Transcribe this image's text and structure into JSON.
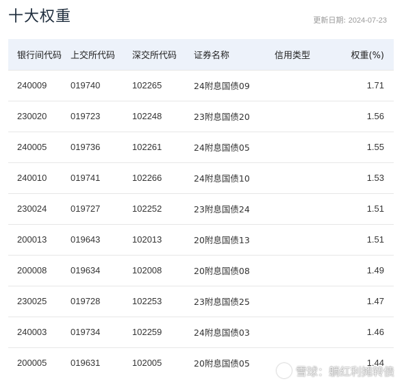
{
  "title": "十大权重",
  "update": {
    "label": "更新日期:",
    "date": "2024-07-23"
  },
  "table": {
    "headers": [
      "银行间代码",
      "上交所代码",
      "深交所代码",
      "证券名称",
      "信用类型",
      "权重(%)"
    ],
    "rows": [
      {
        "bank_code": "240009",
        "sh_code": "019740",
        "sz_code": "102265",
        "name": "24附息国债09",
        "credit_type": "",
        "weight": "1.71"
      },
      {
        "bank_code": "230020",
        "sh_code": "019723",
        "sz_code": "102248",
        "name": "23附息国债20",
        "credit_type": "",
        "weight": "1.56"
      },
      {
        "bank_code": "240005",
        "sh_code": "019736",
        "sz_code": "102261",
        "name": "24附息国债05",
        "credit_type": "",
        "weight": "1.55"
      },
      {
        "bank_code": "240010",
        "sh_code": "019741",
        "sz_code": "102266",
        "name": "24附息国债10",
        "credit_type": "",
        "weight": "1.53"
      },
      {
        "bank_code": "230024",
        "sh_code": "019727",
        "sz_code": "102252",
        "name": "23附息国债24",
        "credit_type": "",
        "weight": "1.51"
      },
      {
        "bank_code": "200013",
        "sh_code": "019643",
        "sz_code": "102013",
        "name": "20附息国债13",
        "credit_type": "",
        "weight": "1.51"
      },
      {
        "bank_code": "200008",
        "sh_code": "019634",
        "sz_code": "102008",
        "name": "20附息国债08",
        "credit_type": "",
        "weight": "1.49"
      },
      {
        "bank_code": "230025",
        "sh_code": "019728",
        "sz_code": "102253",
        "name": "23附息国债25",
        "credit_type": "",
        "weight": "1.47"
      },
      {
        "bank_code": "240003",
        "sh_code": "019734",
        "sz_code": "102259",
        "name": "24附息国债03",
        "credit_type": "",
        "weight": "1.46"
      },
      {
        "bank_code": "200005",
        "sh_code": "019631",
        "sz_code": "102005",
        "name": "20附息国债05",
        "credit_type": "",
        "weight": "1.44"
      }
    ]
  },
  "watermark": {
    "text": "雪球：躺红利摊转债"
  },
  "colors": {
    "header_bg": "#edf2fa",
    "row_border": "#e6e6e6",
    "date_text": "#999999"
  }
}
